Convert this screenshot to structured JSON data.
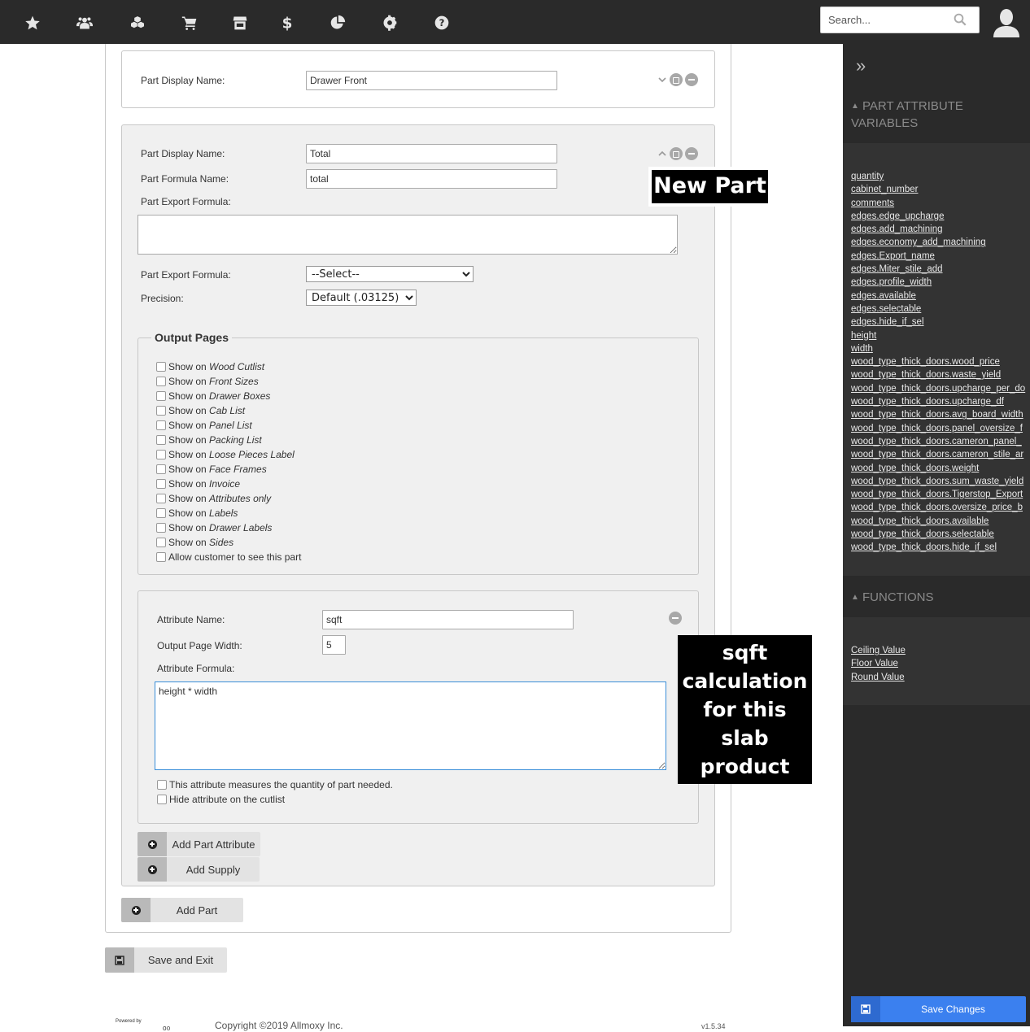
{
  "topbar": {
    "nav_icons": [
      "star-icon",
      "users-icon",
      "cubes-icon",
      "cart-icon",
      "store-icon",
      "dollar-icon",
      "pie-chart-icon",
      "gear-icon",
      "help-icon"
    ],
    "search_placeholder": "Search..."
  },
  "parts": [
    {
      "display_name_label": "Part Display Name:",
      "display_name_value": "Drawer Front",
      "collapsed": true
    },
    {
      "display_name_label": "Part Display Name:",
      "display_name_value": "Total",
      "formula_name_label": "Part Formula Name:",
      "formula_name_value": "total",
      "export_formula_label": "Part Export Formula:",
      "export_formula_value": "",
      "export_select_label": "Part Export Formula:",
      "export_select_value": "--Select--",
      "precision_label": "Precision:",
      "precision_value": "Default (.03125)",
      "output_pages": {
        "legend": "Output Pages",
        "items": [
          {
            "prefix": "Show on ",
            "name": "Wood Cutlist",
            "checked": false
          },
          {
            "prefix": "Show on ",
            "name": "Front Sizes",
            "checked": false
          },
          {
            "prefix": "Show on ",
            "name": "Drawer Boxes",
            "checked": false
          },
          {
            "prefix": "Show on ",
            "name": "Cab List",
            "checked": false
          },
          {
            "prefix": "Show on ",
            "name": "Panel List",
            "checked": false
          },
          {
            "prefix": "Show on ",
            "name": "Packing List",
            "checked": false
          },
          {
            "prefix": "Show on ",
            "name": "Loose Pieces Label",
            "checked": false
          },
          {
            "prefix": "Show on ",
            "name": "Face Frames",
            "checked": false
          },
          {
            "prefix": "Show on ",
            "name": "Invoice",
            "checked": false
          },
          {
            "prefix": "Show on ",
            "name": "Attributes only",
            "checked": false
          },
          {
            "prefix": "Show on ",
            "name": "Labels",
            "checked": false
          },
          {
            "prefix": "Show on ",
            "name": "Drawer Labels",
            "checked": false
          },
          {
            "prefix": "Show on ",
            "name": "Sides",
            "checked": false
          },
          {
            "prefix": "Allow customer to see this part",
            "name": "",
            "checked": false
          }
        ]
      },
      "attribute": {
        "name_label": "Attribute Name:",
        "name_value": "sqft",
        "width_label": "Output Page Width:",
        "width_value": "5",
        "formula_label": "Attribute Formula:",
        "formula_value": "height * width",
        "quantity_checkbox": "This attribute measures the quantity of part needed.",
        "hide_checkbox": "Hide attribute on the cutlist"
      },
      "add_attribute_label": "Add Part Attribute",
      "add_supply_label": "Add Supply"
    }
  ],
  "add_part_label": "Add Part",
  "save_exit_label": "Save and Exit",
  "annotations": {
    "new_part": "New Part",
    "sqft_note": "sqft calculation for this slab product"
  },
  "sidebar": {
    "collapse_icon": "double-chevron-right-icon",
    "variables_heading": "PART ATTRIBUTE VARIABLES",
    "variables": [
      "quantity",
      "cabinet_number",
      "comments",
      "edges.edge_upcharge",
      "edges.add_machining",
      "edges.economy_add_machining",
      "edges.Export_name",
      "edges.Miter_stile_add",
      "edges.profile_width",
      "edges.available",
      "edges.selectable",
      "edges.hide_if_sel",
      "height",
      "width",
      "wood_type_thick_doors.wood_price",
      "wood_type_thick_doors.waste_yield",
      "wood_type_thick_doors.upcharge_per_do",
      "wood_type_thick_doors.upcharge_df",
      "wood_type_thick_doors.avg_board_width",
      "wood_type_thick_doors.panel_oversize_f",
      "wood_type_thick_doors.cameron_panel_",
      "wood_type_thick_doors.cameron_stile_ar",
      "wood_type_thick_doors.weight",
      "wood_type_thick_doors.sum_waste_yield",
      "wood_type_thick_doors.Tigerstop_Export",
      "wood_type_thick_doors.oversize_price_b",
      "wood_type_thick_doors.available",
      "wood_type_thick_doors.selectable",
      "wood_type_thick_doors.hide_if_sel"
    ],
    "functions_heading": "FUNCTIONS",
    "functions": [
      "Ceiling Value",
      "Floor Value",
      "Round Value"
    ],
    "save_changes_label": "Save Changes"
  },
  "footer": {
    "powered_by": "Powered by",
    "copyright": "Copyright ©2019 Allmoxy Inc.",
    "version": "v1.5.34"
  },
  "colors": {
    "topbar_bg": "#2a2a2a",
    "sidebar_bg": "#333333",
    "primary": "#3b80ef"
  }
}
